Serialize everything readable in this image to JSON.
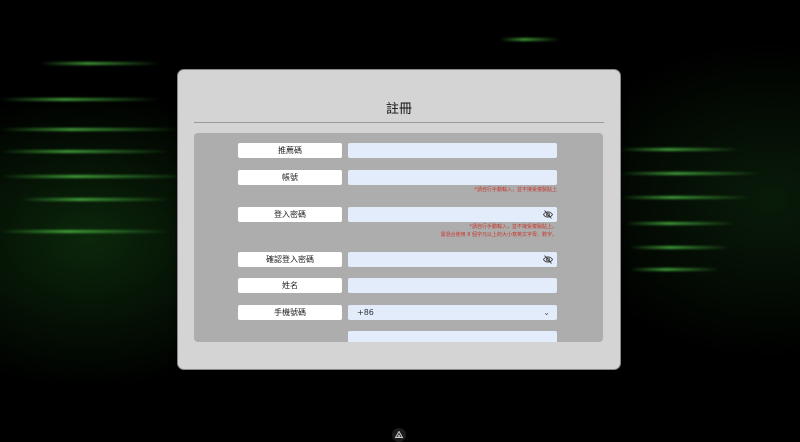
{
  "modal": {
    "title": "註冊"
  },
  "form": {
    "referral_label": "推薦碼",
    "account_label": "帳號",
    "account_hint": "*請自行手動輸入，並不接受複製貼上",
    "password_label": "登入密碼",
    "password_hint_1": "*請自行手動輸入，並不接受複製貼上。",
    "password_hint_2": "需混合使用 8 個字元以上的大小寫英文字母、數字。",
    "confirm_password_label": "確認登入密碼",
    "name_label": "姓名",
    "phone_label": "手機號碼",
    "phone_country_code": "+86"
  },
  "icons": {
    "password_toggle": "eye-slash-icon",
    "dropdown": "chevron-down-icon",
    "brand": "triangle-logo-icon"
  },
  "colors": {
    "modal_bg": "#d4d4d4",
    "panel_bg": "#adadad",
    "field_bg": "#e3ecfb",
    "hint": "#c8362a"
  }
}
